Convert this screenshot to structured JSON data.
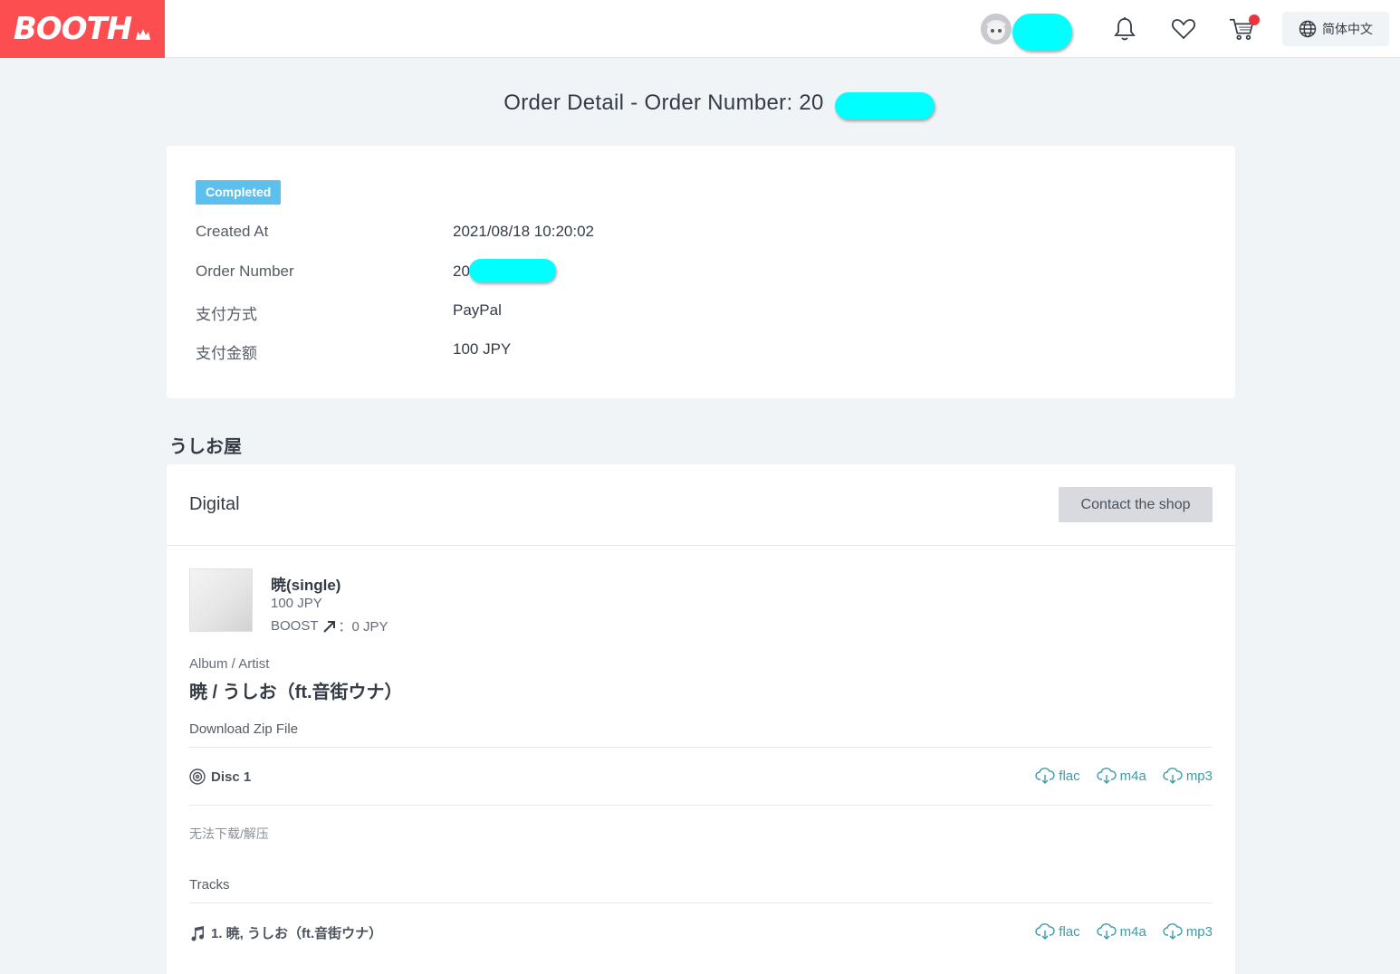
{
  "header": {
    "logo": "BOOTH",
    "language": "简体中文",
    "icons": [
      "bell-icon",
      "heart-icon",
      "cart-icon",
      "globe-icon"
    ],
    "cart_has_notification": true,
    "brand_color": "#fc4d50"
  },
  "page": {
    "title": "Order Detail - Order Number: 20"
  },
  "summary": {
    "status": "Completed",
    "status_color": "#5bc0eb",
    "rows": [
      {
        "label": "Created At",
        "value": "2021/08/18 10:20:02"
      },
      {
        "label": "Order Number",
        "value": "20"
      },
      {
        "label": "支付方式",
        "value": "PayPal"
      },
      {
        "label": "支付金额",
        "value": "100 JPY"
      }
    ]
  },
  "shop": {
    "name": "うしお屋",
    "type": "Digital",
    "contact_label": "Contact the shop"
  },
  "item": {
    "title": "暁(single)",
    "price": "100 JPY",
    "boost_label": "BOOST",
    "boost_value": "：0 JPY",
    "album_artist_label": "Album / Artist",
    "album_artist": "暁 / うしお（ft.音街ウナ）",
    "download_zip_label": "Download Zip File",
    "disc_label": "Disc 1",
    "formats": [
      "flac",
      "m4a",
      "mp3"
    ],
    "cannot_download": "无法下载/解压",
    "tracks_label": "Tracks",
    "track_1": "1. 暁, うしお（ft.音街ウナ）"
  }
}
